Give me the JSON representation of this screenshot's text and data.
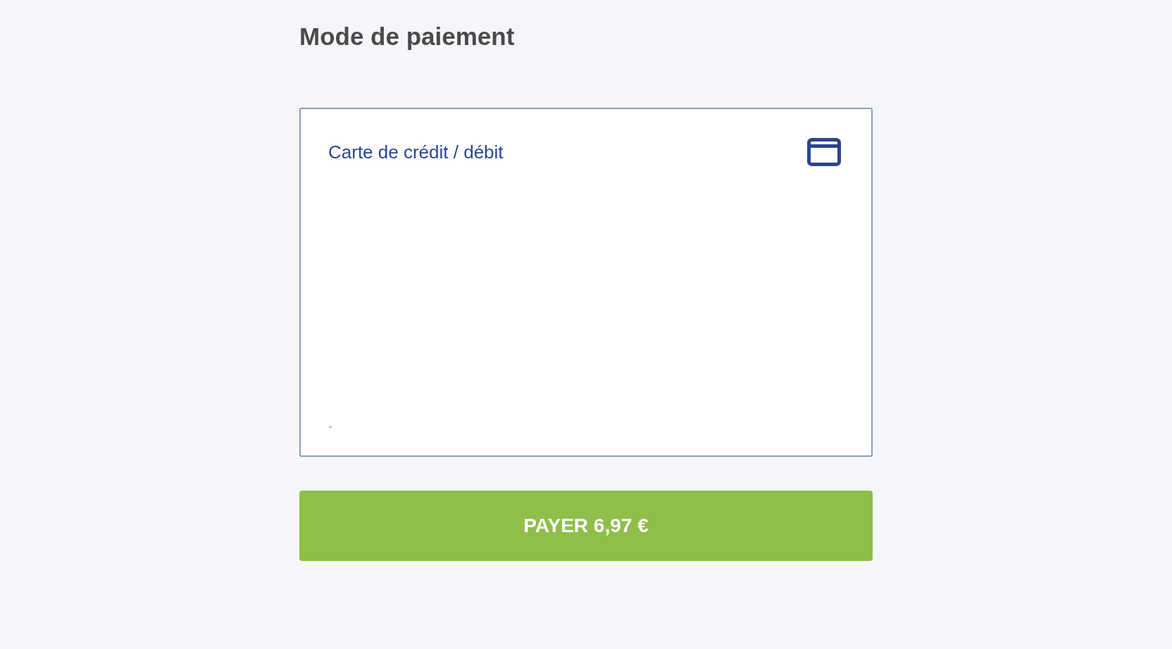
{
  "page": {
    "title": "Mode de paiement"
  },
  "payment_method": {
    "label": "Carte de crédit / débit",
    "note": "-"
  },
  "pay_button": {
    "label": "PAYER 6,97 €"
  }
}
